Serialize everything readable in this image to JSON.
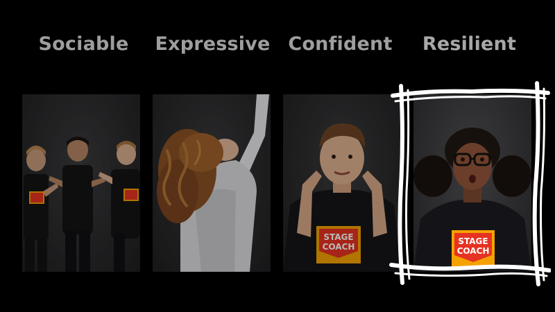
{
  "headings": [
    "Sociable",
    "Expressive",
    "Confident",
    "Resilient"
  ],
  "logo": {
    "line1": "STAGE",
    "line2": "COACH"
  },
  "colors": {
    "background": "#000000",
    "heading": "#9e9e9e",
    "logo_red": "#e63222",
    "logo_orange": "#f5a200",
    "frame": "#ffffff"
  },
  "highlighted_panel": "Resilient"
}
